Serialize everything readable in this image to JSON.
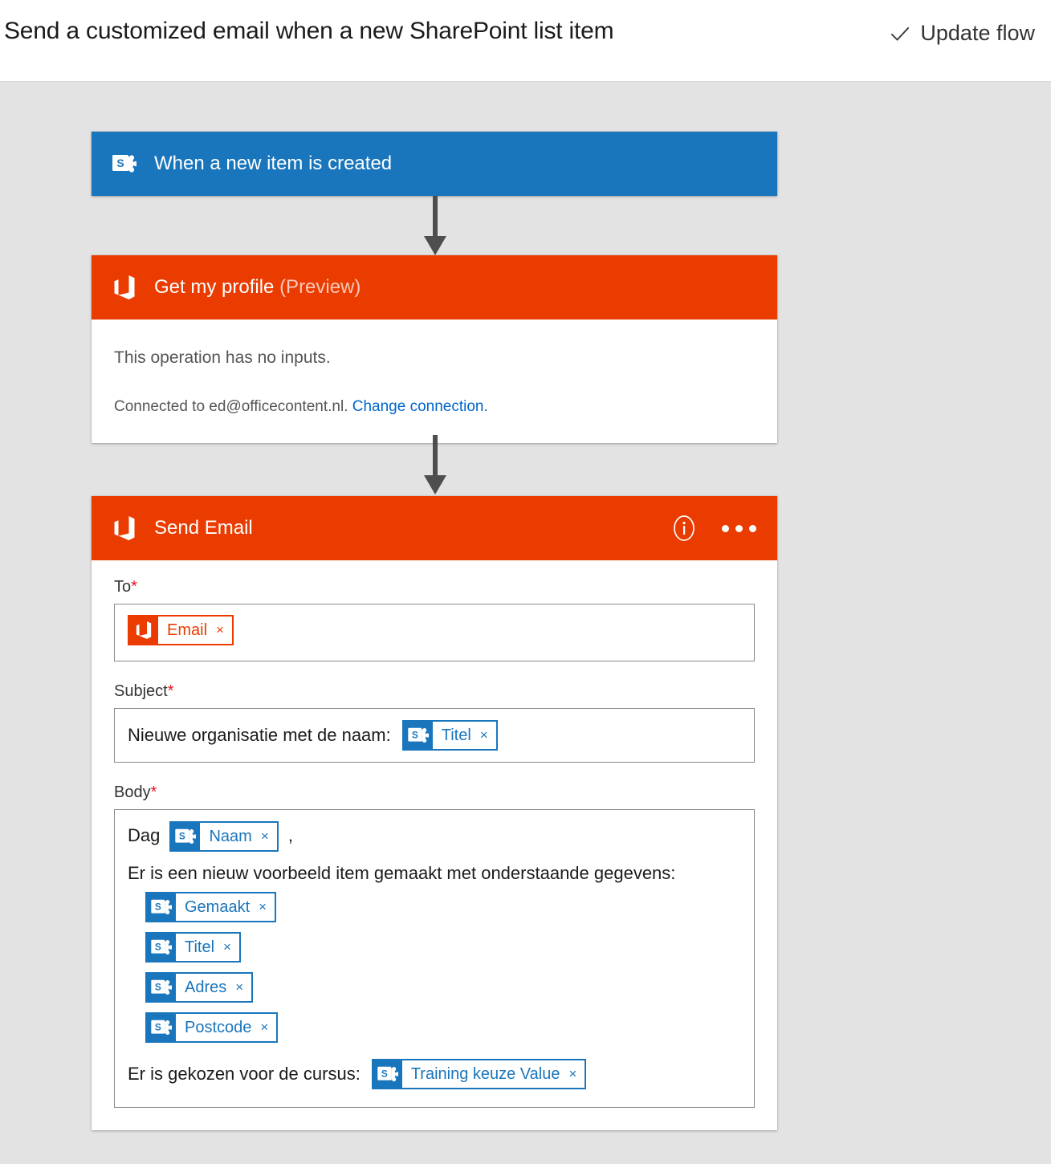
{
  "header": {
    "flow_title": "Send a customized email when a new SharePoint list item",
    "update_flow_label": "Update flow",
    "check_icon": "check-icon"
  },
  "colors": {
    "sharepoint_blue": "#1a76bc",
    "office_orange": "#ea3c00",
    "canvas_background": "#e3e3e3",
    "link_blue": "#0066cc",
    "required_red": "#e81123"
  },
  "flow": {
    "trigger": {
      "title": "When a new item is created",
      "icon": "sharepoint-icon",
      "accent": "#1a76bc"
    },
    "get_profile": {
      "title": "Get my profile",
      "title_suffix": "(Preview)",
      "icon": "office365-icon",
      "accent": "#ea3c00",
      "no_inputs_text": "This operation has no inputs.",
      "connected_text": "Connected to ed@officecontent.nl.",
      "change_connection_link": "Change connection."
    },
    "send_email": {
      "title": "Send Email",
      "icon": "office365-icon",
      "accent": "#ea3c00",
      "info_icon": "info-icon",
      "more_icon": "ellipsis-icon",
      "fields": {
        "to": {
          "label": "To",
          "required_marker": "*",
          "tokens": [
            {
              "text": "Email",
              "source": "office365",
              "remove": "×"
            }
          ]
        },
        "subject": {
          "label": "Subject",
          "required_marker": "*",
          "text": "Nieuwe organisatie met de naam:",
          "tokens": [
            {
              "text": "Titel",
              "source": "sharepoint",
              "remove": "×"
            }
          ]
        },
        "body": {
          "label": "Body",
          "required_marker": "*",
          "greeting_prefix": "Dag",
          "greeting_token": {
            "text": "Naam",
            "source": "sharepoint",
            "remove": "×"
          },
          "greeting_suffix": ",",
          "paragraph": "Er is een nieuw voorbeeld item gemaakt met onderstaande gegevens:",
          "token_list": [
            {
              "text": "Gemaakt",
              "source": "sharepoint",
              "remove": "×"
            },
            {
              "text": "Titel",
              "source": "sharepoint",
              "remove": "×"
            },
            {
              "text": "Adres",
              "source": "sharepoint",
              "remove": "×"
            },
            {
              "text": "Postcode",
              "source": "sharepoint",
              "remove": "×"
            }
          ],
          "closing_text": "Er is gekozen voor de cursus:",
          "closing_token": {
            "text": "Training keuze Value",
            "source": "sharepoint",
            "remove": "×"
          }
        }
      }
    }
  }
}
